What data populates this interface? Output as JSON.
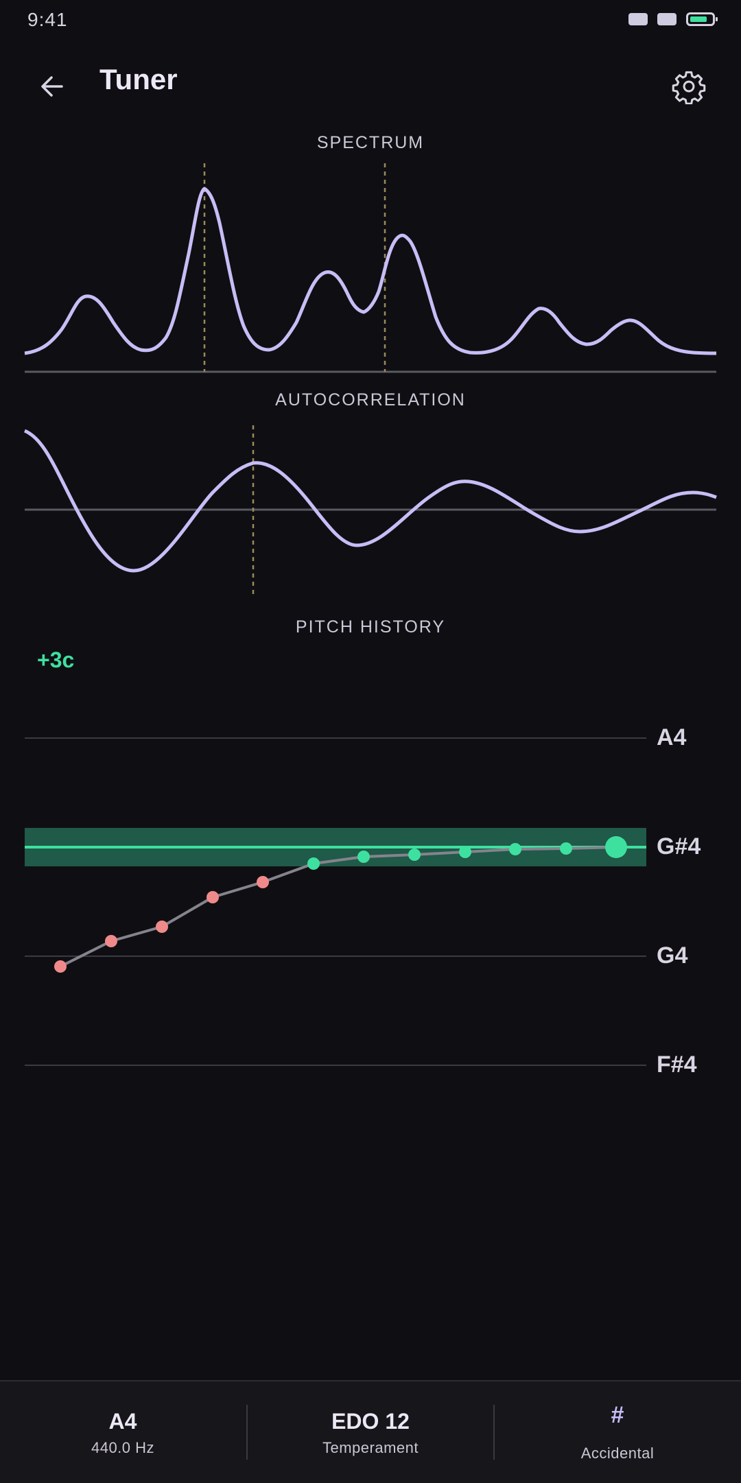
{
  "status_bar": {
    "time": "9:41"
  },
  "app_bar": {
    "title": "Tuner",
    "back_icon": "arrow-left-icon",
    "settings_icon": "gear-icon"
  },
  "spectrum": {
    "label": "SPECTRUM"
  },
  "autocorrelation": {
    "label": "AUTOCORRELATION"
  },
  "pitch_history": {
    "label": "PITCH HISTORY",
    "deviation": "+3c",
    "notes": [
      "A4",
      "G#4",
      "G4",
      "F#4"
    ],
    "target_note": "G#4",
    "in_tune_color": "#3ee0a0",
    "out_of_tune_color": "#f08a8a"
  },
  "bottom_bar": {
    "reference": {
      "value": "A4",
      "sub": "440.0 Hz"
    },
    "temperament": {
      "value": "EDO 12",
      "sub": "Temperament"
    },
    "accidental": {
      "value": "#",
      "sub": "Accidental"
    }
  },
  "colors": {
    "accent": "#c8bdf6",
    "marker": "#9c8a5a",
    "background": "#0f0f13"
  }
}
